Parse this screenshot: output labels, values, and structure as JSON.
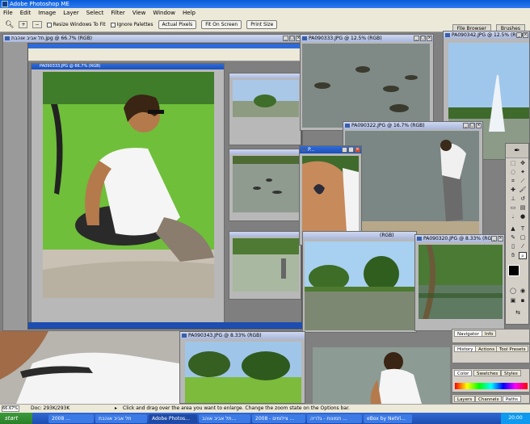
{
  "app": {
    "title": "Adobe Photoshop ME",
    "menu": [
      "File",
      "Edit",
      "Image",
      "Layer",
      "Select",
      "Filter",
      "View",
      "Window",
      "Help"
    ]
  },
  "options": {
    "checkbox1": "Resize Windows To Fit",
    "checkbox2": "Ignore Palettes",
    "actual_pixels": "Actual Pixels",
    "fit_on_screen": "Fit On Screen",
    "print_size": "Print Size",
    "file_browser_tab": "File Browser",
    "brushes_tab": "Brushes"
  },
  "windows": {
    "w_main": "תל אביב אוהבת.jpg @ 66.7% (RGB)",
    "w_inner": "PA090333.JPG @ 66.7% (RGB)",
    "w1": "PA090333.JPG @ 12.5% (RGB)",
    "w2": "PA090342.JPG @ 12.5% (RGB)",
    "w3": "PA090322.JPG @ 16.7% (RGB)",
    "w4": "P...",
    "w5": "PA090320.JPG @ 8.33% (RGB)",
    "w6": "PA090343.JPG @ 8.33% (RGB)",
    "w6b": "(RGB)"
  },
  "panels": {
    "navigator": "Navigator",
    "info": "Info",
    "history": "History",
    "actions": "Actions",
    "tool_presets": "Tool Presets",
    "color": "Color",
    "swatches": "Swatches",
    "styles": "Styles",
    "layers": "Layers",
    "channels": "Channels",
    "paths": "Paths"
  },
  "status": {
    "zoom": "66.67%",
    "doc": "Doc: 293K/293K",
    "hint": "Click and drag over the area you want to enlarge. Change the zoom state on the Options bar."
  },
  "taskbar": {
    "start": "start",
    "tasks": [
      "2008 ...",
      "תל אביב אוהבת",
      "Adobe Photos...",
      "תל אביב אוהב...",
      "2008 - צילומים ...",
      "תמונות - גלריה ...",
      "eBox by NetVi..."
    ],
    "time": "20:00"
  },
  "colors": {
    "title_blue": "#0a5bd8",
    "chrome": "#ece9d8",
    "workspace": "#808080"
  }
}
